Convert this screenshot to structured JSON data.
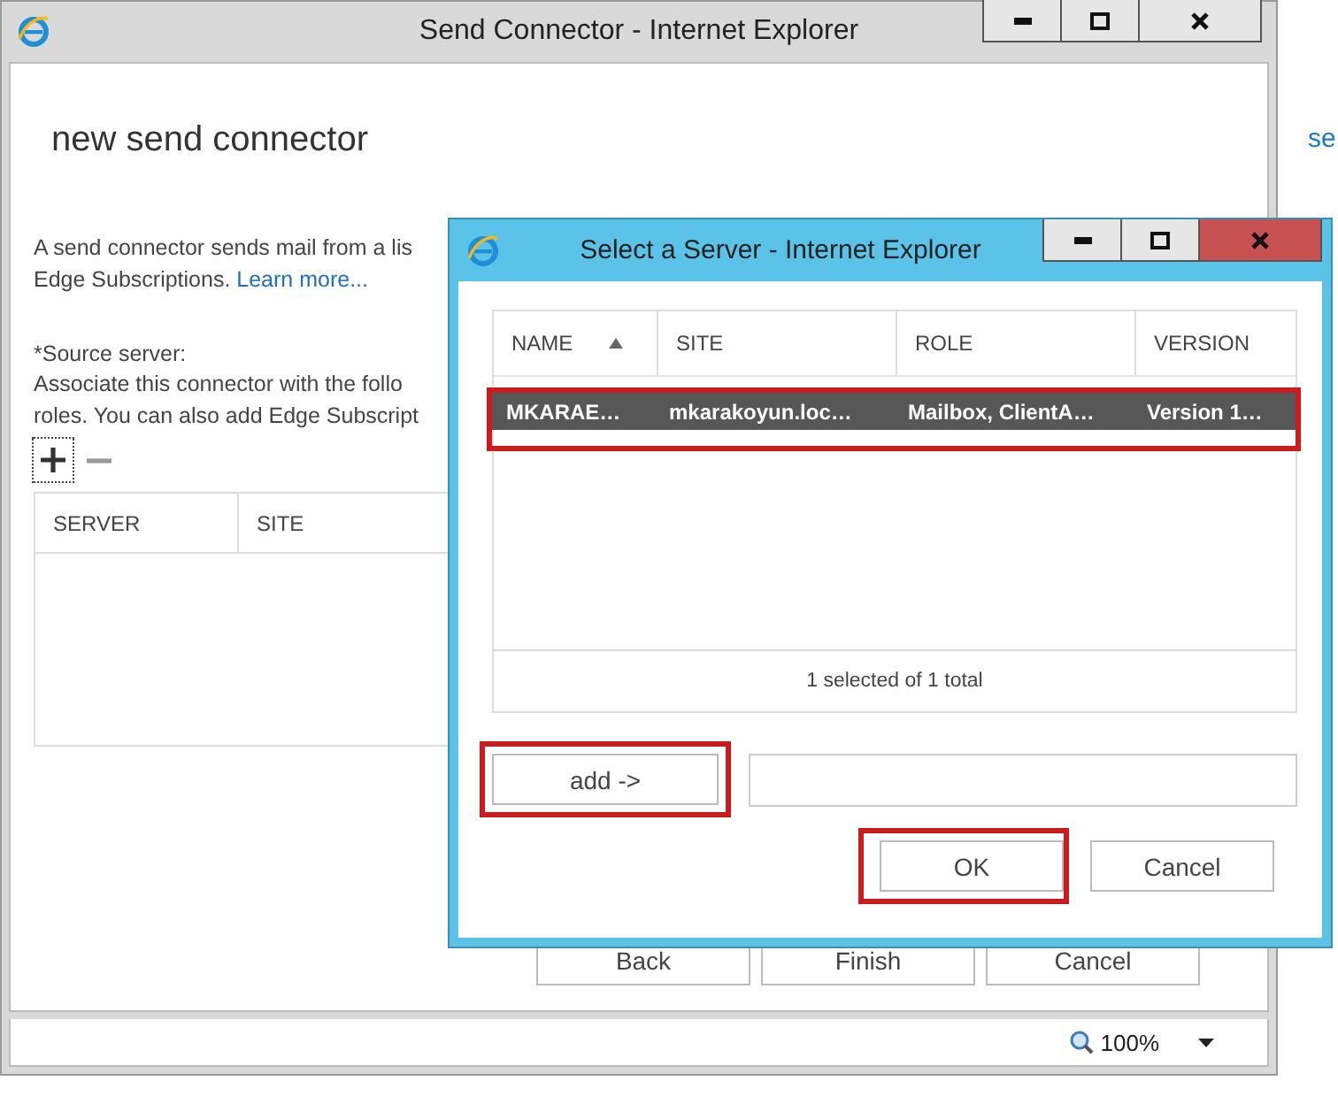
{
  "background_link": "se",
  "main_window": {
    "title": "Send Connector - Internet Explorer",
    "heading": "new send connector",
    "description_lines": [
      "A send connector sends mail from a lis",
      "Edge Subscriptions."
    ],
    "learn_more_link": "Learn more...",
    "source_label": "*Source server:",
    "source_help_lines": [
      "Associate this connector with the follo",
      "roles. You can also add Edge Subscript"
    ],
    "table": {
      "columns": [
        "SERVER",
        "SITE"
      ]
    },
    "buttons": [
      "Back",
      "Finish",
      "Cancel"
    ],
    "status_bar": {
      "zoom": "100%"
    }
  },
  "dialog": {
    "title": "Select a Server - Internet Explorer",
    "table": {
      "columns": [
        {
          "label": "NAME",
          "sorted": true
        },
        {
          "label": "SITE",
          "sorted": false
        },
        {
          "label": "ROLE",
          "sorted": false
        },
        {
          "label": "VERSION",
          "sorted": false
        }
      ],
      "rows": [
        {
          "cells": [
            "MKARAE…",
            "mkarakoyun.loc…",
            "Mailbox, ClientA…",
            "Version 1…"
          ],
          "selected": true,
          "highlighted": true
        }
      ],
      "footer": "1 selected of 1 total"
    },
    "add_button": {
      "label": "add ->",
      "highlighted": true
    },
    "buttons": [
      {
        "label": "OK",
        "highlighted": true
      },
      {
        "label": "Cancel",
        "highlighted": false
      }
    ]
  }
}
